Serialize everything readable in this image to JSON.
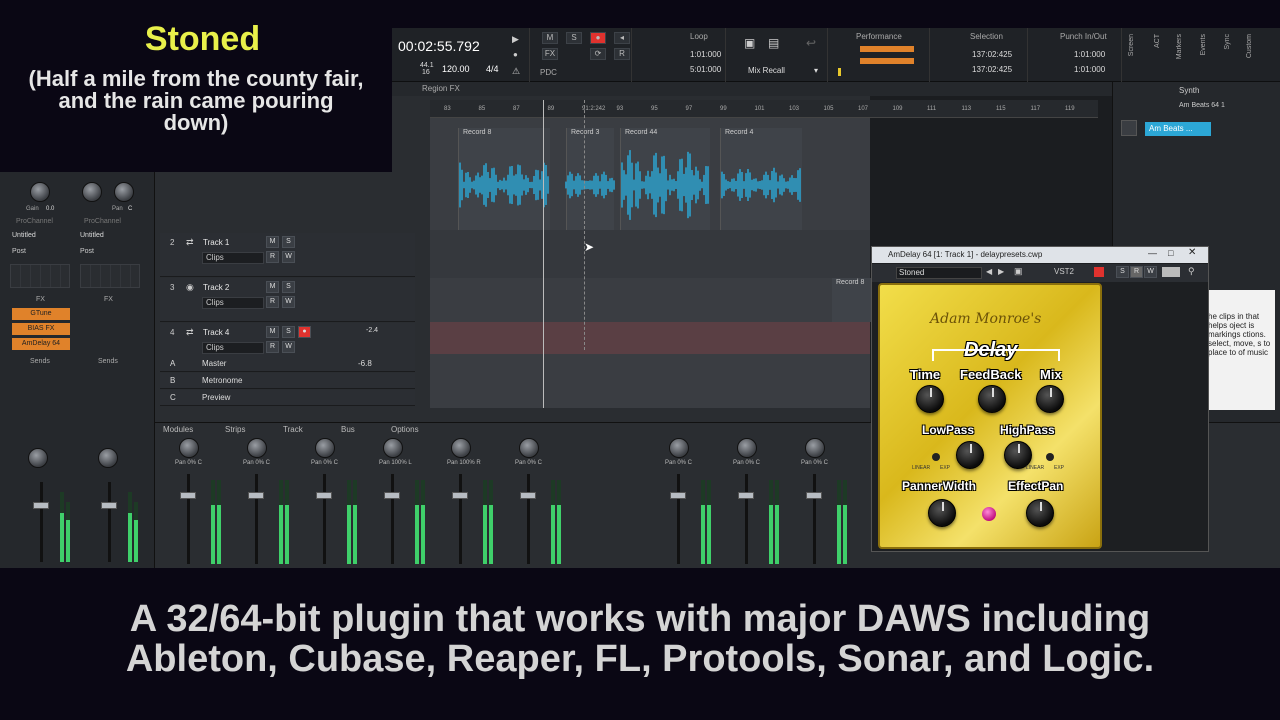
{
  "overlay": {
    "song_title": "Stoned",
    "song_subtitle_line1": "(Half a mile from the county fair,",
    "song_subtitle_line2": "and the rain came pouring",
    "song_subtitle_line3": "down)",
    "caption_line1": "A 32/64-bit plugin that works with major DAWS including",
    "caption_line2": "Ableton, Cubase, Reaper, FL, Protools, Sonar, and Logic."
  },
  "control_bar": {
    "time": "00:02:55.792",
    "sample_rate": "44.1",
    "bit_depth": "16",
    "tempo": "120.00",
    "meter": "4/4",
    "loop_label": "Loop",
    "loop_start": "1:01:000",
    "loop_end": "5:01:000",
    "mix_recall": "Mix Recall",
    "performance_label": "Performance",
    "selection_label": "Selection",
    "selection_start": "137:02:425",
    "selection_end": "137:02:425",
    "punch_label": "Punch In/Out",
    "punch_start": "1:01:000",
    "punch_end": "1:01:000",
    "pdc": "PDC",
    "synth_label": "Synth",
    "m_btn": "M",
    "s_btn": "S",
    "r_btn": "R",
    "fx_btn": "FX"
  },
  "left_strip": {
    "gain_label": "Gain",
    "gain_value": "0.0",
    "pan_label": "Pan",
    "pan_value": "C",
    "prochannel": "ProChannel",
    "untitled": "Untitled",
    "post": "Post",
    "fx_label": "FX",
    "fx_items": [
      "GTune",
      "BIAS FX",
      "AmDelay 64"
    ],
    "sends_label": "Sends"
  },
  "region_fx": "Region FX",
  "ruler_ticks": [
    "83",
    "85",
    "87",
    "89",
    "91:2:242",
    "93",
    "95",
    "97",
    "99",
    "101",
    "103",
    "105",
    "107",
    "109",
    "111",
    "113",
    "115",
    "117",
    "119"
  ],
  "clips": [
    {
      "label": "Record 8"
    },
    {
      "label": "Record 3"
    },
    {
      "label": "Record 44"
    },
    {
      "label": "Record 4"
    }
  ],
  "clip_track3_label": "Record 8",
  "tracks": [
    {
      "num": "2",
      "name": "Track 1",
      "mode": "Clips",
      "vol": ""
    },
    {
      "num": "3",
      "name": "Track 2",
      "mode": "Clips",
      "vol": ""
    },
    {
      "num": "4",
      "name": "Track 4",
      "mode": "Clips",
      "vol": "-2.4"
    }
  ],
  "buses": [
    {
      "letter": "A",
      "name": "Master",
      "vol": "-6.8"
    },
    {
      "letter": "B",
      "name": "Metronome",
      "vol": ""
    },
    {
      "letter": "C",
      "name": "Preview",
      "vol": ""
    }
  ],
  "mixer": {
    "tabs": [
      "Modules",
      "Strips",
      "Track",
      "Bus",
      "Options"
    ],
    "pan_labels": [
      "Pan 0% C",
      "Pan 0% C",
      "Pan 0% C",
      "Pan 100% L",
      "Pan 100% R",
      "Pan 0% C",
      "Pan 0% C",
      "Pan 0% C",
      "Pan 0% C"
    ]
  },
  "browser": {
    "title": "Am Beats 64 1",
    "item": "Am Beats ...",
    "help_text": "he clips in that helps oject is markings ctions. select, move, s to place to of music"
  },
  "side_tabs": [
    "Screen",
    "ACT",
    "Markers",
    "Events",
    "Sync",
    "Custom"
  ],
  "plugin": {
    "window_title": "AmDelay 64 [1: Track 1] - delaypresets.cwp",
    "preset": "Stoned",
    "format": "VST2",
    "brand": "Adam Monroe's",
    "name": "Delay",
    "labels": {
      "time": "Time",
      "feedback": "FeedBack",
      "mix": "Mix",
      "lowpass": "LowPass",
      "highpass": "HighPass",
      "pannerwidth": "PannerWidth",
      "effectpan": "EffectPan",
      "linear": "LINEAR",
      "exp": "EXP"
    }
  },
  "colors": {
    "accent_blue": "#2ca7d6",
    "record_red": "#e0322e",
    "pedal_gold": "#e8c82c",
    "fx_orange": "#e0822a",
    "title_yellow": "#e8f04a"
  }
}
